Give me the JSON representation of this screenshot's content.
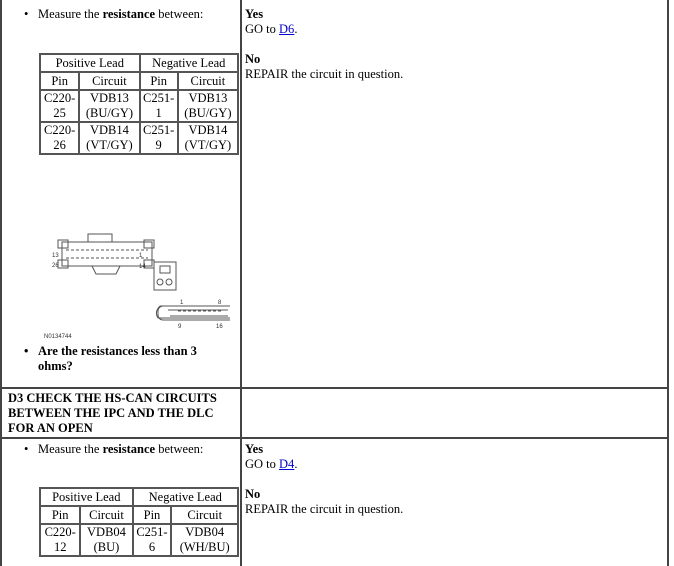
{
  "steps": [
    {
      "instruction": {
        "pre": "Measure the ",
        "bold": "resistance",
        "post": " between:"
      },
      "table": {
        "group_headers": [
          "Positive Lead",
          "Negative Lead"
        ],
        "col_headers": [
          "Pin",
          "Circuit",
          "Pin",
          "Circuit"
        ],
        "rows": [
          [
            "C220-25",
            "VDB13 (BU/GY)",
            "C251-1",
            "VDB13 (BU/GY)"
          ],
          [
            "C220-26",
            "VDB14 (VT/GY)",
            "C251-9",
            "VDB14 (VT/GY)"
          ]
        ]
      },
      "figure": {
        "label": "N0134744",
        "pins": [
          "13",
          "1",
          "26",
          "14",
          "1",
          "8",
          "9",
          "16"
        ]
      },
      "question": "Are the resistances less than 3 ohms?",
      "yes": {
        "label": "Yes",
        "text": "GO to ",
        "link": "D6",
        "end": "."
      },
      "no": {
        "label": "No",
        "text": "REPAIR the circuit in question."
      }
    },
    {
      "title": "D3 CHECK THE HS-CAN CIRCUITS BETWEEN THE IPC AND THE DLC FOR AN OPEN",
      "instruction": {
        "pre": "Measure the ",
        "bold": "resistance",
        "post": " between:"
      },
      "table": {
        "group_headers": [
          "Positive Lead",
          "Negative Lead"
        ],
        "col_headers": [
          "Pin",
          "Circuit",
          "Pin",
          "Circuit"
        ],
        "rows": [
          [
            "C220-12",
            "VDB04 (BU)",
            "C251-6",
            "VDB04 (WH/BU)"
          ]
        ]
      },
      "yes": {
        "label": "Yes",
        "text": "GO to ",
        "link": "D4",
        "end": "."
      },
      "no": {
        "label": "No",
        "text": "REPAIR the circuit in question."
      }
    }
  ]
}
